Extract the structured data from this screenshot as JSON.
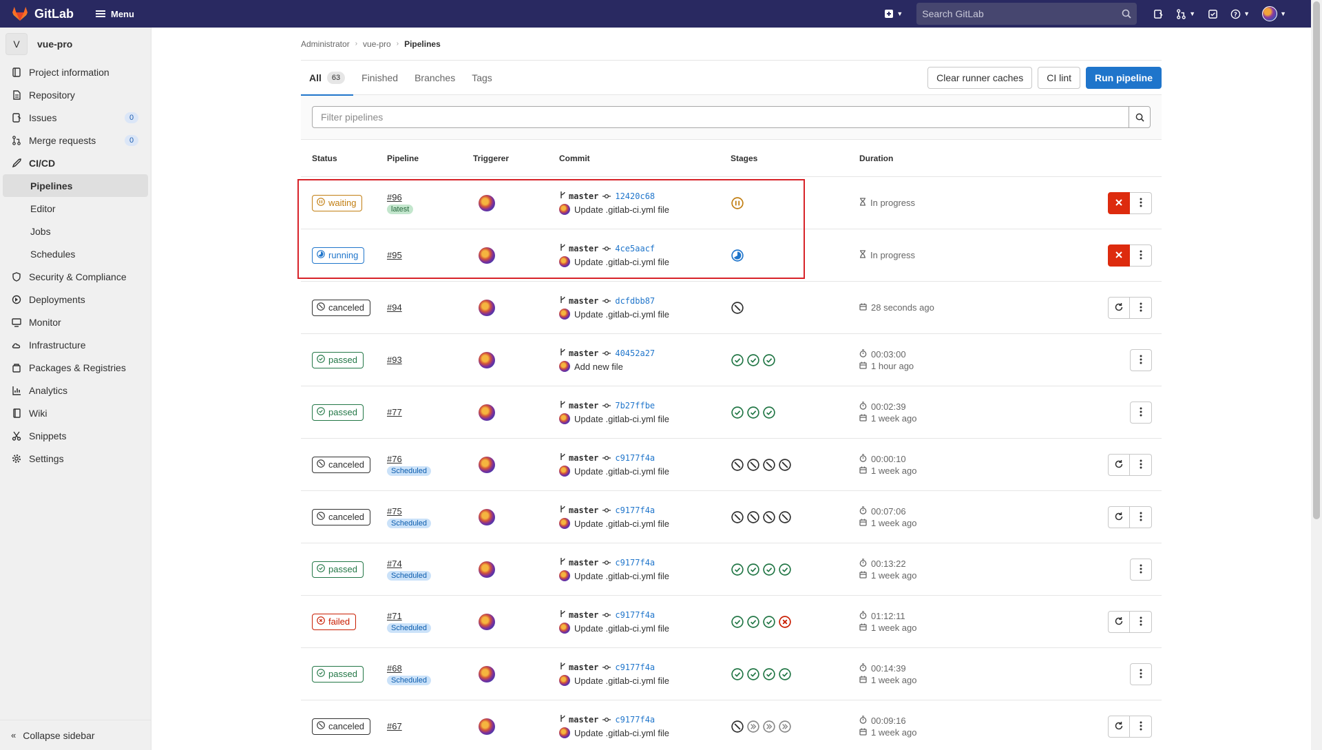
{
  "brand": {
    "name": "GitLab"
  },
  "topbar": {
    "menu_label": "Menu",
    "search_placeholder": "Search GitLab"
  },
  "sidebar": {
    "project_initial": "V",
    "project_name": "vue-pro",
    "items": [
      {
        "label": "Project information",
        "icon": "info-icon"
      },
      {
        "label": "Repository",
        "icon": "doc-icon"
      },
      {
        "label": "Issues",
        "icon": "issues-icon",
        "count": "0"
      },
      {
        "label": "Merge requests",
        "icon": "merge-request-icon",
        "count": "0"
      },
      {
        "label": "CI/CD",
        "icon": "rocket-icon"
      }
    ],
    "cicd_sub": [
      "Pipelines",
      "Editor",
      "Jobs",
      "Schedules"
    ],
    "items2": [
      {
        "label": "Security & Compliance",
        "icon": "shield-icon"
      },
      {
        "label": "Deployments",
        "icon": "deployments-icon"
      },
      {
        "label": "Monitor",
        "icon": "monitor-icon"
      },
      {
        "label": "Infrastructure",
        "icon": "cloud-icon"
      },
      {
        "label": "Packages & Registries",
        "icon": "package-icon"
      },
      {
        "label": "Analytics",
        "icon": "chart-icon"
      },
      {
        "label": "Wiki",
        "icon": "book-icon"
      },
      {
        "label": "Snippets",
        "icon": "snippet-icon"
      },
      {
        "label": "Settings",
        "icon": "gear-icon"
      }
    ],
    "collapse_label": "Collapse sidebar"
  },
  "breadcrumb": {
    "root": "Administrator",
    "project": "vue-pro",
    "current": "Pipelines"
  },
  "tabs": {
    "all": "All",
    "all_count": "63",
    "finished": "Finished",
    "branches": "Branches",
    "tags": "Tags"
  },
  "actions": {
    "clear_caches": "Clear runner caches",
    "ci_lint": "CI lint",
    "run_pipeline": "Run pipeline"
  },
  "filter": {
    "placeholder": "Filter pipelines"
  },
  "table": {
    "headers": {
      "status": "Status",
      "pipeline": "Pipeline",
      "triggerer": "Triggerer",
      "commit": "Commit",
      "stages": "Stages",
      "duration": "Duration"
    },
    "rows": [
      {
        "status": "waiting",
        "id": "#96",
        "tag": "latest",
        "branch": "master",
        "sha": "12420c68",
        "message": "Update .gitlab-ci.yml file",
        "stages": [
          "waiting"
        ],
        "duration": "",
        "finished": "In progress",
        "actions": [
          "cancel",
          "more"
        ]
      },
      {
        "status": "running",
        "id": "#95",
        "tag": "",
        "branch": "master",
        "sha": "4ce5aacf",
        "message": "Update .gitlab-ci.yml file",
        "stages": [
          "running"
        ],
        "duration": "",
        "finished": "In progress",
        "actions": [
          "cancel",
          "more"
        ]
      },
      {
        "status": "canceled",
        "id": "#94",
        "tag": "",
        "branch": "master",
        "sha": "dcfdbb87",
        "message": "Update .gitlab-ci.yml file",
        "stages": [
          "canceled"
        ],
        "duration": "",
        "finished": "28 seconds ago",
        "actions": [
          "retry",
          "more"
        ]
      },
      {
        "status": "passed",
        "id": "#93",
        "tag": "",
        "branch": "master",
        "sha": "40452a27",
        "message": "Add new file",
        "stages": [
          "passed",
          "passed",
          "passed"
        ],
        "duration": "00:03:00",
        "finished": "1 hour ago",
        "actions": [
          "more"
        ]
      },
      {
        "status": "passed",
        "id": "#77",
        "tag": "",
        "branch": "master",
        "sha": "7b27ffbe",
        "message": "Update .gitlab-ci.yml file",
        "stages": [
          "passed",
          "passed",
          "passed"
        ],
        "duration": "00:02:39",
        "finished": "1 week ago",
        "actions": [
          "more"
        ]
      },
      {
        "status": "canceled",
        "id": "#76",
        "tag": "Scheduled",
        "branch": "master",
        "sha": "c9177f4a",
        "message": "Update .gitlab-ci.yml file",
        "stages": [
          "canceled",
          "canceled",
          "canceled",
          "canceled"
        ],
        "duration": "00:00:10",
        "finished": "1 week ago",
        "actions": [
          "retry",
          "more"
        ]
      },
      {
        "status": "canceled",
        "id": "#75",
        "tag": "Scheduled",
        "branch": "master",
        "sha": "c9177f4a",
        "message": "Update .gitlab-ci.yml file",
        "stages": [
          "canceled",
          "canceled",
          "canceled",
          "canceled"
        ],
        "duration": "00:07:06",
        "finished": "1 week ago",
        "actions": [
          "retry",
          "more"
        ]
      },
      {
        "status": "passed",
        "id": "#74",
        "tag": "Scheduled",
        "branch": "master",
        "sha": "c9177f4a",
        "message": "Update .gitlab-ci.yml file",
        "stages": [
          "passed",
          "passed",
          "passed",
          "passed"
        ],
        "duration": "00:13:22",
        "finished": "1 week ago",
        "actions": [
          "more"
        ]
      },
      {
        "status": "failed",
        "id": "#71",
        "tag": "Scheduled",
        "branch": "master",
        "sha": "c9177f4a",
        "message": "Update .gitlab-ci.yml file",
        "stages": [
          "passed",
          "passed",
          "passed",
          "failed"
        ],
        "duration": "01:12:11",
        "finished": "1 week ago",
        "actions": [
          "retry",
          "more"
        ]
      },
      {
        "status": "passed",
        "id": "#68",
        "tag": "Scheduled",
        "branch": "master",
        "sha": "c9177f4a",
        "message": "Update .gitlab-ci.yml file",
        "stages": [
          "passed",
          "passed",
          "passed",
          "passed"
        ],
        "duration": "00:14:39",
        "finished": "1 week ago",
        "actions": [
          "more"
        ]
      },
      {
        "status": "canceled",
        "id": "#67",
        "tag": "",
        "branch": "master",
        "sha": "c9177f4a",
        "message": "Update .gitlab-ci.yml file",
        "stages": [
          "canceled",
          "skipped",
          "skipped",
          "skipped"
        ],
        "duration": "00:09:16",
        "finished": "1 week ago",
        "actions": [
          "retry",
          "more"
        ]
      }
    ]
  },
  "colors": {
    "navbar": "#292961",
    "primary": "#1f75cb",
    "danger": "#dd2b0e",
    "passed": "#217645",
    "waiting": "#c17d10",
    "failed": "#c91c00",
    "highlight": "#d72127"
  }
}
